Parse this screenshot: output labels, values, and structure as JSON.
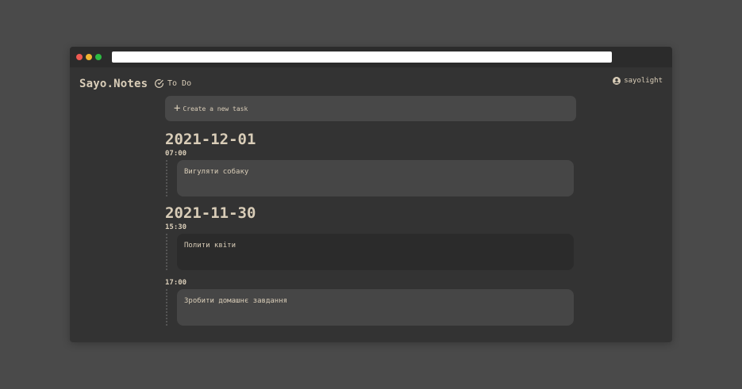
{
  "app": {
    "brand": "Sayo.Notes",
    "nav_label": "To Do",
    "username": "sayolight"
  },
  "create_task": {
    "label": "Create a new task"
  },
  "groups": [
    {
      "date": "2021-12-01",
      "entries": [
        {
          "time": "07:00",
          "text": "Вигуляти собаку"
        }
      ]
    },
    {
      "date": "2021-11-30",
      "entries": [
        {
          "time": "15:30",
          "text": "Полити квіти"
        },
        {
          "time": "17:00",
          "text": "Зробити домашнє завдання"
        }
      ]
    }
  ],
  "icons": {
    "nav": "check-circle-icon",
    "user": "user-circle-icon",
    "create": "plus-icon"
  },
  "colors": {
    "background": "#4a4a4a",
    "window": "#333333",
    "text": "#d9cdb8",
    "card_light": "#464646",
    "card_dark": "#2b2b2b"
  }
}
